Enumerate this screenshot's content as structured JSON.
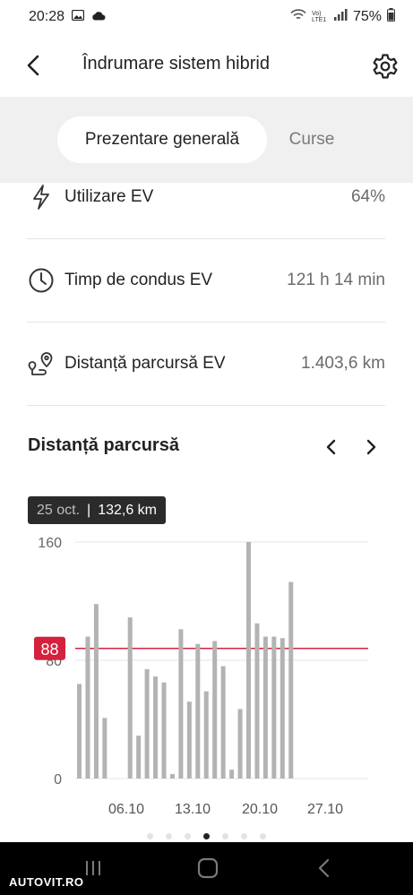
{
  "status_bar": {
    "time": "20:28",
    "battery": "75%",
    "network_label": "Vo) LTE1"
  },
  "header": {
    "title": "Îndrumare sistem hibrid"
  },
  "tabs": [
    {
      "label": "Prezentare generală",
      "active": true
    },
    {
      "label": "Curse",
      "active": false
    }
  ],
  "metrics": [
    {
      "icon": "lightning-icon",
      "label": "Utilizare EV",
      "value": "64%"
    },
    {
      "icon": "clock-icon",
      "label": "Timp de condus EV",
      "value": "121 h 14 min"
    },
    {
      "icon": "route-pin-icon",
      "label": "Distanță parcursă EV",
      "value": "1.403,6 km"
    }
  ],
  "chart_section": {
    "title": "Distanță parcursă"
  },
  "tooltip": {
    "date": "25 oct.",
    "value": "132,6 km"
  },
  "chart_data": {
    "type": "bar",
    "ylim": [
      0,
      160
    ],
    "y_ticks": [
      "160",
      "80",
      "0"
    ],
    "x_labels": [
      "06.10",
      "13.10",
      "20.10",
      "27.10"
    ],
    "average_label": "88",
    "average": 88,
    "highlight_index": 27,
    "values": [
      64,
      96,
      118,
      41,
      0,
      0,
      109,
      29,
      74,
      69,
      65,
      3,
      101,
      52,
      91,
      59,
      93,
      76,
      6,
      47,
      160,
      105,
      96,
      96,
      95,
      133,
      0,
      0
    ],
    "colors": {
      "bar": "#b3b3b3",
      "highlight": "#2b2b2b",
      "average_line": "#d4213d",
      "grid": "#e6e6e6"
    }
  },
  "pager": {
    "count": 7,
    "active_index": 3
  },
  "watermark": "AUTOVIT.RO"
}
